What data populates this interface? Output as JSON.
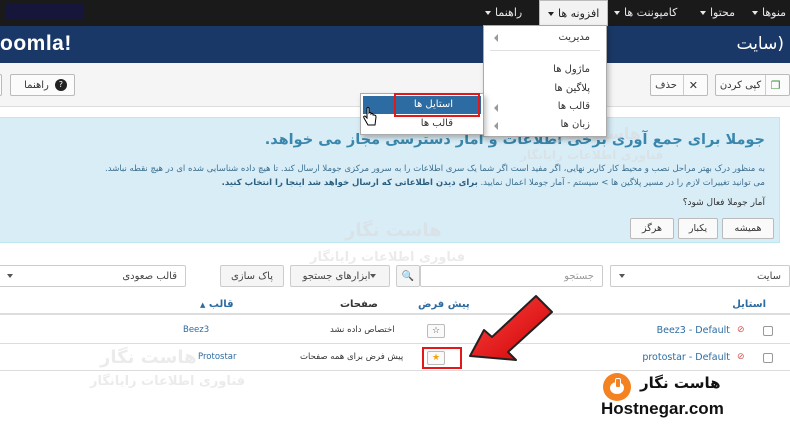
{
  "topbar": {
    "items": [
      "منوها",
      "محتوا",
      "کامپوننت ها",
      "افزونه ها",
      "راهنما"
    ]
  },
  "header": {
    "brand": "oomla!",
    "site_title": "سایت)"
  },
  "toolbar": {
    "copy": "کپی کردن",
    "delete": "حذف",
    "help": "راهنما"
  },
  "menu": {
    "main": [
      "مدیریت",
      "ماژول ها",
      "پلاگین ها",
      "قالب ها",
      "زبان ها"
    ],
    "submenu": [
      "استایل ها",
      "قالب ها"
    ]
  },
  "banner": {
    "title": "جوملا برای جمع آوری برخی اطلاعات و آمار دسترسی مجاز می خواهد.",
    "line1": "به منظور درک بهتر مراحل نصب و محیط کار کاربر نهایی، اگر مفید است اگر شما یک سری اطلاعات را به سرور مرکزی جوملا ارسال کند. تا هیچ داده شناسایی شده ای در هیچ نقطه نباشد.",
    "line2_plain": "می توانید تغییرات لازم را در مسیر پلاگین ها > سیستم - آمار جوملا اعمال نمایید.",
    "line2_bold": "برای دیدن اطلاعاتی که ارسال خواهد شد اینجا را انتخاب کنید.",
    "question": "آمار جوملا فعال شود؟",
    "buttons": [
      "همیشه",
      "یکبار",
      "هرگز"
    ]
  },
  "filters": {
    "site_select": "سایت",
    "search_placeholder": "جستجو",
    "search_tools": "ابزارهای جستجو",
    "clear": "پاک سازی",
    "sort": "قالب صعودی"
  },
  "table": {
    "headers": {
      "style": "استایل",
      "default": "پیش فرض",
      "pages": "صفحات",
      "template": "قالب"
    },
    "rows": [
      {
        "style": "Beez3 - Default",
        "pages": "اختصاص داده نشد",
        "template": "Beez3"
      },
      {
        "style": "protostar - Default",
        "pages": "پیش فرض برای همه صفحات",
        "template": "Protostar"
      }
    ]
  },
  "watermark": {
    "fa": "هاست نگار",
    "sub": "فناوری اطلاعات رایانگار"
  },
  "logo": {
    "fa": "هاست نگار",
    "en": "Hostnegar.com"
  },
  "colors": {
    "header_blue": "#1a3867",
    "menu_highlight": "#2d6ca2",
    "annotation_red": "#e3181a",
    "brand_orange": "#f58220"
  }
}
